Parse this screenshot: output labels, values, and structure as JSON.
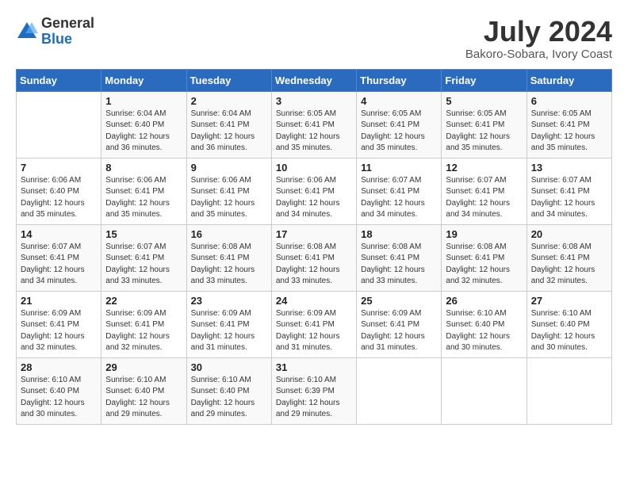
{
  "header": {
    "logo_general": "General",
    "logo_blue": "Blue",
    "month_title": "July 2024",
    "location": "Bakoro-Sobara, Ivory Coast"
  },
  "days_of_week": [
    "Sunday",
    "Monday",
    "Tuesday",
    "Wednesday",
    "Thursday",
    "Friday",
    "Saturday"
  ],
  "weeks": [
    [
      {
        "day": "",
        "info": ""
      },
      {
        "day": "1",
        "info": "Sunrise: 6:04 AM\nSunset: 6:40 PM\nDaylight: 12 hours\nand 36 minutes."
      },
      {
        "day": "2",
        "info": "Sunrise: 6:04 AM\nSunset: 6:41 PM\nDaylight: 12 hours\nand 36 minutes."
      },
      {
        "day": "3",
        "info": "Sunrise: 6:05 AM\nSunset: 6:41 PM\nDaylight: 12 hours\nand 35 minutes."
      },
      {
        "day": "4",
        "info": "Sunrise: 6:05 AM\nSunset: 6:41 PM\nDaylight: 12 hours\nand 35 minutes."
      },
      {
        "day": "5",
        "info": "Sunrise: 6:05 AM\nSunset: 6:41 PM\nDaylight: 12 hours\nand 35 minutes."
      },
      {
        "day": "6",
        "info": "Sunrise: 6:05 AM\nSunset: 6:41 PM\nDaylight: 12 hours\nand 35 minutes."
      }
    ],
    [
      {
        "day": "7",
        "info": "Sunrise: 6:06 AM\nSunset: 6:40 PM\nDaylight: 12 hours\nand 35 minutes."
      },
      {
        "day": "8",
        "info": "Sunrise: 6:06 AM\nSunset: 6:41 PM\nDaylight: 12 hours\nand 35 minutes."
      },
      {
        "day": "9",
        "info": "Sunrise: 6:06 AM\nSunset: 6:41 PM\nDaylight: 12 hours\nand 35 minutes."
      },
      {
        "day": "10",
        "info": "Sunrise: 6:06 AM\nSunset: 6:41 PM\nDaylight: 12 hours\nand 34 minutes."
      },
      {
        "day": "11",
        "info": "Sunrise: 6:07 AM\nSunset: 6:41 PM\nDaylight: 12 hours\nand 34 minutes."
      },
      {
        "day": "12",
        "info": "Sunrise: 6:07 AM\nSunset: 6:41 PM\nDaylight: 12 hours\nand 34 minutes."
      },
      {
        "day": "13",
        "info": "Sunrise: 6:07 AM\nSunset: 6:41 PM\nDaylight: 12 hours\nand 34 minutes."
      }
    ],
    [
      {
        "day": "14",
        "info": "Sunrise: 6:07 AM\nSunset: 6:41 PM\nDaylight: 12 hours\nand 34 minutes."
      },
      {
        "day": "15",
        "info": "Sunrise: 6:07 AM\nSunset: 6:41 PM\nDaylight: 12 hours\nand 33 minutes."
      },
      {
        "day": "16",
        "info": "Sunrise: 6:08 AM\nSunset: 6:41 PM\nDaylight: 12 hours\nand 33 minutes."
      },
      {
        "day": "17",
        "info": "Sunrise: 6:08 AM\nSunset: 6:41 PM\nDaylight: 12 hours\nand 33 minutes."
      },
      {
        "day": "18",
        "info": "Sunrise: 6:08 AM\nSunset: 6:41 PM\nDaylight: 12 hours\nand 33 minutes."
      },
      {
        "day": "19",
        "info": "Sunrise: 6:08 AM\nSunset: 6:41 PM\nDaylight: 12 hours\nand 32 minutes."
      },
      {
        "day": "20",
        "info": "Sunrise: 6:08 AM\nSunset: 6:41 PM\nDaylight: 12 hours\nand 32 minutes."
      }
    ],
    [
      {
        "day": "21",
        "info": "Sunrise: 6:09 AM\nSunset: 6:41 PM\nDaylight: 12 hours\nand 32 minutes."
      },
      {
        "day": "22",
        "info": "Sunrise: 6:09 AM\nSunset: 6:41 PM\nDaylight: 12 hours\nand 32 minutes."
      },
      {
        "day": "23",
        "info": "Sunrise: 6:09 AM\nSunset: 6:41 PM\nDaylight: 12 hours\nand 31 minutes."
      },
      {
        "day": "24",
        "info": "Sunrise: 6:09 AM\nSunset: 6:41 PM\nDaylight: 12 hours\nand 31 minutes."
      },
      {
        "day": "25",
        "info": "Sunrise: 6:09 AM\nSunset: 6:41 PM\nDaylight: 12 hours\nand 31 minutes."
      },
      {
        "day": "26",
        "info": "Sunrise: 6:10 AM\nSunset: 6:40 PM\nDaylight: 12 hours\nand 30 minutes."
      },
      {
        "day": "27",
        "info": "Sunrise: 6:10 AM\nSunset: 6:40 PM\nDaylight: 12 hours\nand 30 minutes."
      }
    ],
    [
      {
        "day": "28",
        "info": "Sunrise: 6:10 AM\nSunset: 6:40 PM\nDaylight: 12 hours\nand 30 minutes."
      },
      {
        "day": "29",
        "info": "Sunrise: 6:10 AM\nSunset: 6:40 PM\nDaylight: 12 hours\nand 29 minutes."
      },
      {
        "day": "30",
        "info": "Sunrise: 6:10 AM\nSunset: 6:40 PM\nDaylight: 12 hours\nand 29 minutes."
      },
      {
        "day": "31",
        "info": "Sunrise: 6:10 AM\nSunset: 6:39 PM\nDaylight: 12 hours\nand 29 minutes."
      },
      {
        "day": "",
        "info": ""
      },
      {
        "day": "",
        "info": ""
      },
      {
        "day": "",
        "info": ""
      }
    ]
  ]
}
